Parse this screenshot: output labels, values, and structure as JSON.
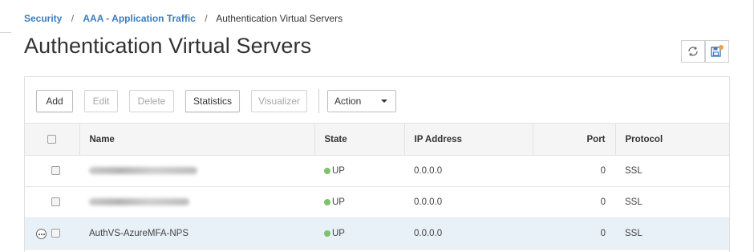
{
  "breadcrumb": {
    "items": [
      "Security",
      "AAA - Application Traffic"
    ],
    "separator": "/",
    "current": "Authentication Virtual Servers"
  },
  "page": {
    "title": "Authentication Virtual Servers"
  },
  "header_icons": [
    "refresh-icon",
    "save-config-icon"
  ],
  "toolbar": {
    "add": "Add",
    "edit": "Edit",
    "delete": "Delete",
    "statistics": "Statistics",
    "visualizer": "Visualizer",
    "action_select": "Action"
  },
  "table": {
    "headers": [
      "Name",
      "State",
      "IP Address",
      "Port",
      "Protocol"
    ],
    "rows": [
      {
        "name": "",
        "state": "UP",
        "ip": "0.0.0.0",
        "port": "0",
        "protocol": "SSL"
      },
      {
        "name": "",
        "state": "UP",
        "ip": "0.0.0.0",
        "port": "0",
        "protocol": "SSL"
      },
      {
        "name": "AuthVS-AzureMFA-NPS",
        "state": "UP",
        "ip": "0.0.0.0",
        "port": "0",
        "protocol": "SSL"
      }
    ]
  },
  "colors": {
    "link": "#3c7dbf",
    "status_up": "#7cc36a",
    "selected_row": "#e8f0f8",
    "save_icon_accent": "#f2a04a"
  }
}
